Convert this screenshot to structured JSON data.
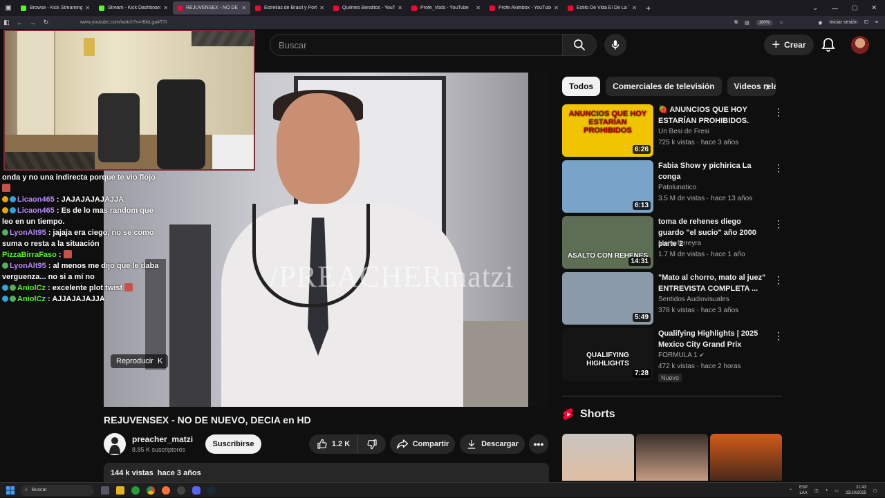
{
  "browser": {
    "tabs": [
      {
        "label": "Browse - Kick Streaming",
        "color": "#53fc18"
      },
      {
        "label": "Stream - Kick Dashboard",
        "color": "#53fc18"
      },
      {
        "label": "REJUVENSEX - NO DE NUEVO",
        "color": "#ff0033",
        "active": true
      },
      {
        "label": "Estrellas de Brasil y Portugal en",
        "color": "#ff0033"
      },
      {
        "label": "Quilmes Benditos - YouTube",
        "color": "#ff0033"
      },
      {
        "label": "Profe_Vods - YouTube",
        "color": "#ff0033"
      },
      {
        "label": "Profe Akimbox - YouTube",
        "color": "#ff0033"
      },
      {
        "label": "Estilo De Vida El De La Tacoma",
        "color": "#ff0033"
      }
    ],
    "url": "www.youtube.com/watch?v=I6ikLga4T7I",
    "zoom": "160%",
    "signin": "Iniciar sesión"
  },
  "header": {
    "search_placeholder": "Buscar",
    "create_label": "Crear"
  },
  "player": {
    "watermark": "/PREACHERmatzi",
    "play_hint": "Reproducir",
    "play_hint_key": "K"
  },
  "chat": [
    {
      "user": "",
      "text": "onda y no una indirecta porque te vio flojo",
      "user_color": "#ffffff",
      "emote": true
    },
    {
      "user": "Licaon465",
      "text": " : JAJAJAJAJAJJA",
      "user_color": "#b88cff",
      "badges": [
        "#e8a800",
        "#2ea6d9"
      ]
    },
    {
      "user": "Licaon465",
      "text": " : Es de lo mas random que leo en un tiempo.",
      "user_color": "#b88cff",
      "badges": [
        "#e8a800",
        "#2ea6d9"
      ]
    },
    {
      "user": "LyonAlt95",
      "text": " : jajaja era ciego, no se como suma o resta a la situación",
      "user_color": "#b88cff",
      "badges": [
        "#53b05a"
      ]
    },
    {
      "user": "PizzaBirraFaso",
      "text": " : ",
      "user_color": "#53fc18",
      "badges": [],
      "emote": true
    },
    {
      "user": "LyonAlt95",
      "text": " : al menos me dijo que le daba verguenza... no si a mí no",
      "user_color": "#b88cff",
      "badges": [
        "#53b05a"
      ]
    },
    {
      "user": "AniolCz",
      "text": " : excelente plot twist",
      "user_color": "#53fc18",
      "badges": [
        "#2ea6d9",
        "#53b05a"
      ],
      "emote": true
    },
    {
      "user": "AniolCz",
      "text": " : AJJAJAJAJJA",
      "user_color": "#53fc18",
      "badges": [
        "#2ea6d9",
        "#53b05a"
      ]
    }
  ],
  "chips": [
    "Todos",
    "Comerciales de televisión",
    "Videos relacionados"
  ],
  "recommendations": [
    {
      "title": "🍓 ANUNCIOS QUE HOY ESTARÍAN PROHIBIDOS.",
      "channel": "Un Besi de Fresi",
      "meta": "725 k vistas · hace 3 años",
      "duration": "6:26",
      "thumb_text": "ANUNCIOS QUE HOY ESTARÍAN PROHIBIDOS",
      "thumb_color": "#f0c400"
    },
    {
      "title": "Fabia Show y pichirica   La conga",
      "channel": "Patolunatico",
      "meta": "3.5 M de vistas · hace 13 años",
      "duration": "6:13",
      "thumb_text": "",
      "thumb_color": "#7aa3c8"
    },
    {
      "title": "toma de rehenes diego guardo \"el sucio\" año 2000 parte 2",
      "channel": "Manu ferreyra",
      "meta": "1.7 M de vistas · hace 1 año",
      "duration": "14:31",
      "thumb_text": "ASALTO CON REHENES",
      "thumb_color": "#5d6e55"
    },
    {
      "title": "\"Mato al chorro, mato al juez\" ENTREVISTA COMPLETA ...",
      "channel": "Sentidos Audiovisuales",
      "meta": "378 k vistas · hace 3 años",
      "duration": "5:49",
      "thumb_text": "",
      "thumb_color": "#8a9aa8"
    },
    {
      "title": "Qualifying Highlights | 2025 Mexico City Grand Prix",
      "channel": "FORMULA 1",
      "meta": "472 k vistas · hace 2 horas",
      "duration": "7:28",
      "thumb_text": "QUALIFYING HIGHLIGHTS",
      "thumb_color": "#151515",
      "verified": true,
      "badge": "Nuevo"
    }
  ],
  "shorts": {
    "label": "Shorts"
  },
  "video": {
    "title": "REJUVENSEX - NO DE NUEVO, DECIA en HD",
    "channel": "preacher_matzi",
    "subscribers": "8.85 K suscriptores",
    "subscribe_label": "Suscribirse",
    "likes": "1.2 K",
    "share_label": "Compartir",
    "download_label": "Descargar",
    "views": "144 k vistas",
    "age": "hace 3 años"
  },
  "taskbar": {
    "search": "Buscar",
    "lang": "ESP",
    "lang2": "LAA",
    "time": "21:43",
    "date": "25/10/2025"
  },
  "colors": {
    "accent": "#ff0033",
    "kick": "#53fc18"
  }
}
